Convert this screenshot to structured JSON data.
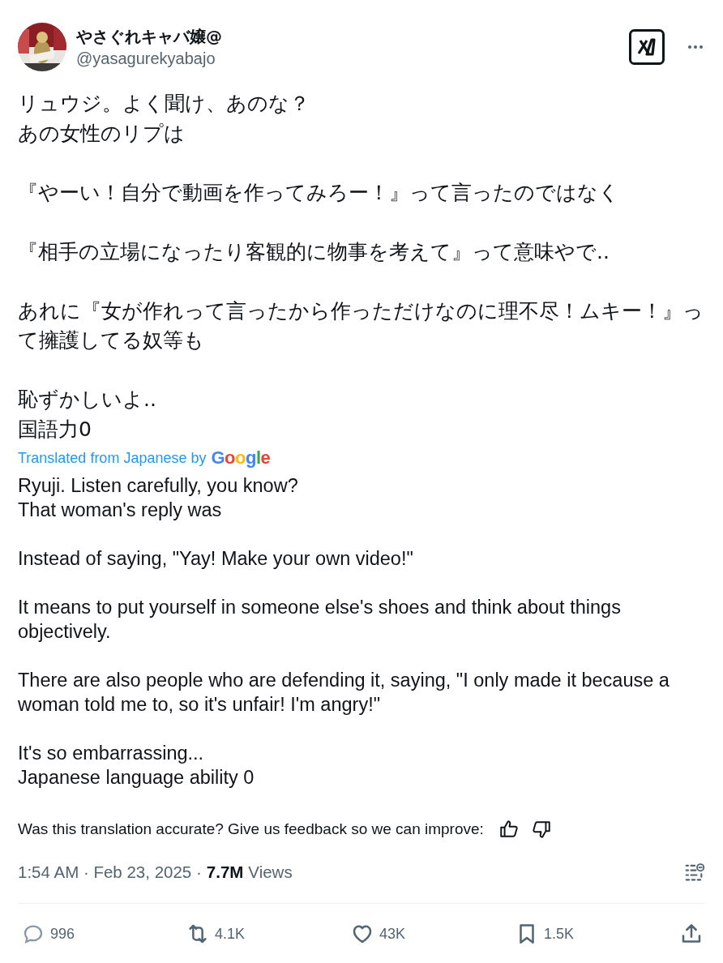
{
  "author": {
    "name": "やさぐれキャバ嬢@",
    "handle": "@yasagurekyabajo"
  },
  "original_text": [
    [
      "リュウジ。よく聞け、あのな？",
      "あの女性のリプは"
    ],
    [
      "『やーい！自分で動画を作ってみろー！』って言ったのではなく"
    ],
    [
      "『相手の立場になったり客観的に物事を考えて』って意味やで.."
    ],
    [
      "あれに『女が作れって言ったから作っただけなのに理不尽！ムキー！』って擁護してる奴等も"
    ],
    [
      "恥ずかしいよ..",
      "国語力0"
    ]
  ],
  "translation_note": {
    "label": "Translated from Japanese by",
    "provider": "Google"
  },
  "translated_text": [
    [
      "Ryuji. Listen carefully, you know?",
      "That woman's reply was"
    ],
    [
      "Instead of saying, \"Yay! Make your own video!\""
    ],
    [
      "It means to put yourself in someone else's shoes and think about things objectively."
    ],
    [
      "There are also people who are defending it, saying, \"I only made it because a woman told me to, so it's unfair! I'm angry!\""
    ],
    [
      "It's so embarrassing...",
      "Japanese language ability 0"
    ]
  ],
  "feedback": {
    "question": "Was this translation accurate? Give us feedback so we can improve:"
  },
  "meta": {
    "timestamp": "1:54 AM · Feb 23, 2025 ·",
    "views": "7.7M",
    "views_label": "Views"
  },
  "actions": [
    {
      "kind": "reply",
      "count": "996"
    },
    {
      "kind": "repost",
      "count": "4.1K"
    },
    {
      "kind": "like",
      "count": "43K"
    },
    {
      "kind": "bookmark",
      "count": "1.5K"
    },
    {
      "kind": "share"
    }
  ]
}
